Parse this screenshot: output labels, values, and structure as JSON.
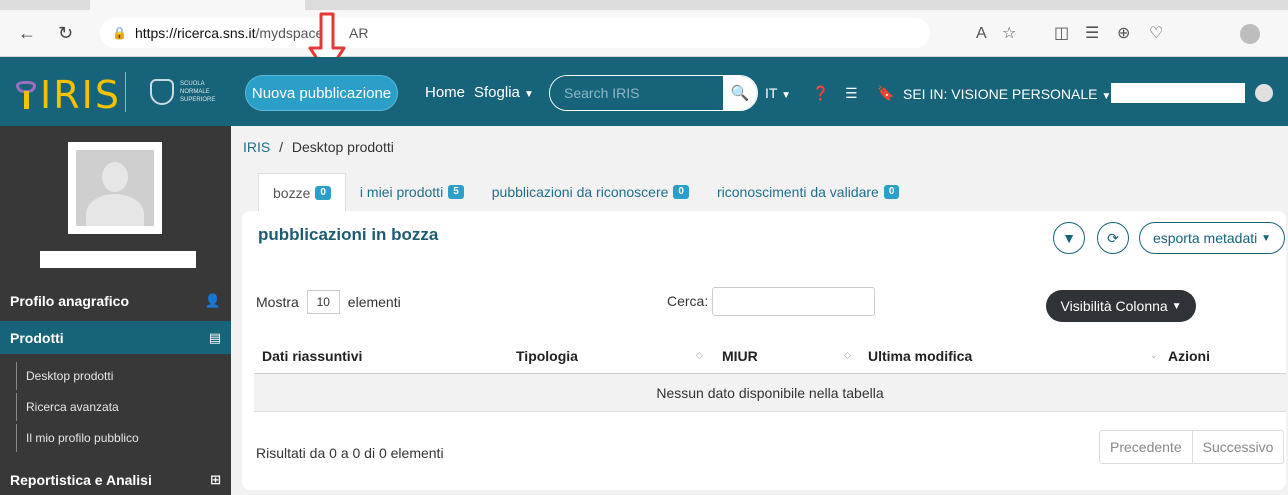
{
  "browser": {
    "url_host": "https://ricerca.sns.it",
    "url_path": "/mydspace?",
    "url_tail": "AR"
  },
  "header": {
    "logo_text": "IRIS",
    "seal_text": "SCUOLA NORMALE SUPERIORE",
    "new_publication": "Nuova pubblicazione",
    "home": "Home",
    "browse": "Sfoglia",
    "search_placeholder": "Search IRIS",
    "language": "IT",
    "view_selector": "SEI IN: VISIONE PERSONALE"
  },
  "sidebar": {
    "sections": [
      {
        "label": "Profilo anagrafico",
        "icon": "person-icon"
      },
      {
        "label": "Prodotti",
        "icon": "book-icon"
      },
      {
        "label": "Reportistica e Analisi",
        "icon": "table-icon"
      }
    ],
    "sub_items": [
      {
        "label": "Desktop prodotti"
      },
      {
        "label": "Ricerca avanzata"
      },
      {
        "label": "Il mio profilo pubblico"
      }
    ]
  },
  "breadcrumb": {
    "root": "IRIS",
    "separator": "/",
    "current": "Desktop prodotti"
  },
  "tabs": [
    {
      "label": "bozze",
      "count": "0"
    },
    {
      "label": "i miei prodotti",
      "count": "5"
    },
    {
      "label": "pubblicazioni da riconoscere",
      "count": "0"
    },
    {
      "label": "riconoscimenti da validare",
      "count": "0"
    }
  ],
  "panel": {
    "title": "pubblicazioni in bozza",
    "export_label": "esporta metadati",
    "show_prefix": "Mostra",
    "show_value": "10",
    "show_suffix": "elementi",
    "search_label": "Cerca:",
    "column_visibility": "Visibilità Colonna",
    "columns": [
      "Dati riassuntivi",
      "Tipologia",
      "MIUR",
      "Ultima modifica",
      "Azioni"
    ],
    "empty_message": "Nessun dato disponibile nella tabella",
    "results_text": "Risultati da 0 a 0 di 0 elementi",
    "prev": "Precedente",
    "next": "Successivo"
  },
  "colors": {
    "header_bg": "#176379",
    "accent": "#2b9fc8",
    "sidebar_bg": "#383838",
    "annotation": "#e53935"
  }
}
